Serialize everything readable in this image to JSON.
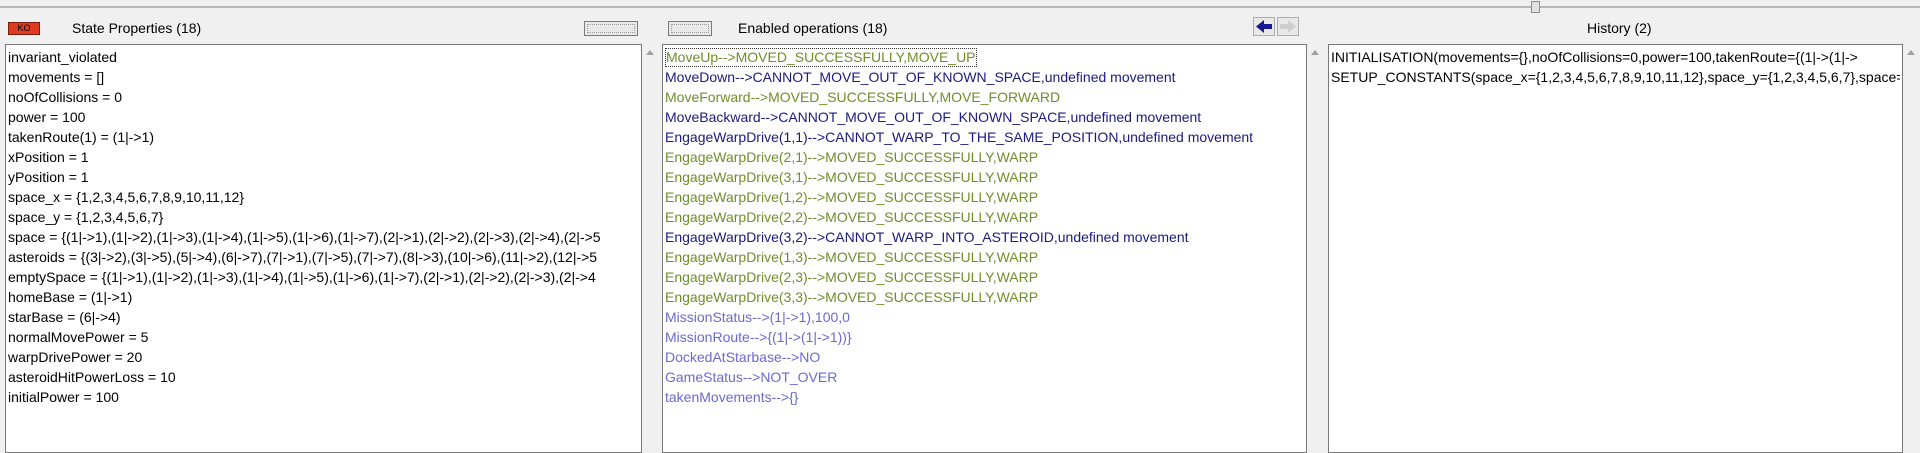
{
  "state_panel": {
    "title": "State Properties (18)",
    "badge": "KO",
    "rows": [
      "invariant_violated",
      "movements = []",
      "noOfCollisions = 0",
      "power = 100",
      "takenRoute(1) = (1|->1)",
      "xPosition = 1",
      "yPosition = 1",
      "space_x = {1,2,3,4,5,6,7,8,9,10,11,12}",
      "space_y = {1,2,3,4,5,6,7}",
      "space = {(1|->1),(1|->2),(1|->3),(1|->4),(1|->5),(1|->6),(1|->7),(2|->1),(2|->2),(2|->3),(2|->4),(2|->5",
      "asteroids = {(3|->2),(3|->5),(5|->4),(6|->7),(7|->1),(7|->5),(7|->7),(8|->3),(10|->6),(11|->2),(12|->5",
      "emptySpace = {(1|->1),(1|->2),(1|->3),(1|->4),(1|->5),(1|->6),(1|->7),(2|->1),(2|->2),(2|->3),(2|->4",
      "homeBase = (1|->1)",
      "starBase = (6|->4)",
      "normalMovePower = 5",
      "warpDrivePower = 20",
      "asteroidHitPowerLoss = 10",
      "initialPower = 100"
    ]
  },
  "operations_panel": {
    "title": "Enabled operations (18)",
    "rows": [
      {
        "text": "MoveUp-->MOVED_SUCCESSFULLY,MOVE_UP",
        "status": "green"
      },
      {
        "text": "MoveDown-->CANNOT_MOVE_OUT_OF_KNOWN_SPACE,undefined movement",
        "status": "navy"
      },
      {
        "text": "MoveForward-->MOVED_SUCCESSFULLY,MOVE_FORWARD",
        "status": "green"
      },
      {
        "text": "MoveBackward-->CANNOT_MOVE_OUT_OF_KNOWN_SPACE,undefined movement",
        "status": "navy"
      },
      {
        "text": "EngageWarpDrive(1,1)-->CANNOT_WARP_TO_THE_SAME_POSITION,undefined movement",
        "status": "navy"
      },
      {
        "text": "EngageWarpDrive(2,1)-->MOVED_SUCCESSFULLY,WARP",
        "status": "green"
      },
      {
        "text": "EngageWarpDrive(3,1)-->MOVED_SUCCESSFULLY,WARP",
        "status": "green"
      },
      {
        "text": "EngageWarpDrive(1,2)-->MOVED_SUCCESSFULLY,WARP",
        "status": "green"
      },
      {
        "text": "EngageWarpDrive(2,2)-->MOVED_SUCCESSFULLY,WARP",
        "status": "green"
      },
      {
        "text": "EngageWarpDrive(3,2)-->CANNOT_WARP_INTO_ASTEROID,undefined movement",
        "status": "navy"
      },
      {
        "text": "EngageWarpDrive(1,3)-->MOVED_SUCCESSFULLY,WARP",
        "status": "green"
      },
      {
        "text": "EngageWarpDrive(2,3)-->MOVED_SUCCESSFULLY,WARP",
        "status": "green"
      },
      {
        "text": "EngageWarpDrive(3,3)-->MOVED_SUCCESSFULLY,WARP",
        "status": "green"
      },
      {
        "text": "MissionStatus-->(1|->1),100,0",
        "status": "purple"
      },
      {
        "text": "MissionRoute-->{(1|->(1|->1))}",
        "status": "purple"
      },
      {
        "text": "DockedAtStarbase-->NO",
        "status": "purple"
      },
      {
        "text": "GameStatus-->NOT_OVER",
        "status": "purple"
      },
      {
        "text": "takenMovements-->{}",
        "status": "purple"
      }
    ]
  },
  "history_panel": {
    "title": "History (2)",
    "rows": [
      "INITIALISATION(movements={},noOfCollisions=0,power=100,takenRoute={(1|->(1|->",
      "SETUP_CONSTANTS(space_x={1,2,3,4,5,6,7,8,9,10,11,12},space_y={1,2,3,4,5,6,7},space="
    ]
  },
  "icons": {
    "back": "arrow-left-icon",
    "forward": "arrow-right-icon",
    "scroll_up": "triangle-up-icon"
  },
  "colors": {
    "green": "#6f8e2a",
    "navy": "#1a1a82",
    "purple": "#6a6ad0",
    "badge": "#e03a1f",
    "nav_arrow": "#1a1a90"
  }
}
